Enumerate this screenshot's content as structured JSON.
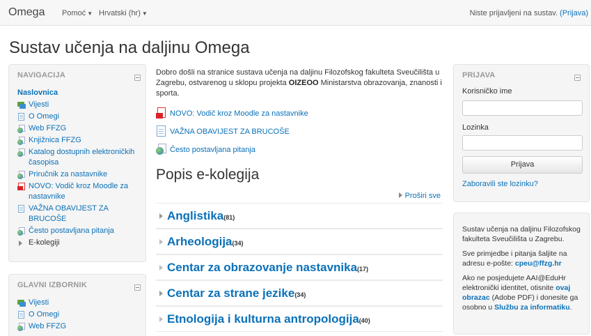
{
  "navbar": {
    "brand": "Omega",
    "help_menu": "Pomoć",
    "language_menu": "Hrvatski (hr)",
    "login_status": "Niste prijavljeni na sustav.",
    "login_link": "(Prijava)"
  },
  "page_title": "Sustav učenja na daljinu Omega",
  "navigation_block": {
    "title": "NAVIGACIJA",
    "items": [
      {
        "label": "Naslovnica",
        "icon": "none"
      },
      {
        "label": "Vijesti",
        "icon": "forum-icon"
      },
      {
        "label": "O Omegi",
        "icon": "page-icon"
      },
      {
        "label": "Web FFZG",
        "icon": "url-icon"
      },
      {
        "label": "Knjižnica FFZG",
        "icon": "url-icon"
      },
      {
        "label": "Katalog dostupnih elektroničkih časopisa",
        "icon": "url-icon"
      },
      {
        "label": "Priručnik za nastavnike",
        "icon": "url-icon"
      },
      {
        "label": "NOVO: Vodič kroz Moodle za nastavnike",
        "icon": "pdf-icon"
      },
      {
        "label": "VAŽNA OBAVIJEST ZA BRUCOŠE",
        "icon": "page-icon"
      },
      {
        "label": "Često postavljana pitanja",
        "icon": "url-icon"
      },
      {
        "label": "E-kolegiji",
        "icon": "expand-arrow-icon"
      }
    ]
  },
  "main_menu_block": {
    "title": "GLAVNI IZBORNIK",
    "items": [
      {
        "label": "Vijesti",
        "icon": "forum-icon"
      },
      {
        "label": "O Omegi",
        "icon": "page-icon"
      },
      {
        "label": "Web FFZG",
        "icon": "url-icon"
      }
    ]
  },
  "main": {
    "intro_pre": "Dobro došli na stranice sustava učenja na daljinu Filozofskog fakulteta Sveučilišta u Zagrebu, ostvarenog u sklopu projekta ",
    "intro_bold": "OIZEOO",
    "intro_post": " Ministarstva obrazovanja, znanosti i sporta.",
    "resources": [
      {
        "label": "NOVO: Vodič kroz Moodle za nastavnike",
        "icon": "pdf-icon"
      },
      {
        "label": "VAŽNA OBAVIJEST ZA BRUCOŠE",
        "icon": "page-icon"
      },
      {
        "label": "Često postavljana pitanja",
        "icon": "url-icon"
      }
    ],
    "section_title": "Popis e-kolegija",
    "expand_all": "Proširi sve",
    "categories": [
      {
        "name": "Anglistika",
        "count": "(81)"
      },
      {
        "name": "Arheologija",
        "count": "(34)"
      },
      {
        "name": "Centar za obrazovanje nastavnika",
        "count": "(17)"
      },
      {
        "name": "Centar za strane jezike",
        "count": "(34)"
      },
      {
        "name": "Etnologija i kulturna antropologija",
        "count": "(40)"
      }
    ]
  },
  "login_block": {
    "title": "PRIJAVA",
    "username_label": "Korisničko ime",
    "password_label": "Lozinka",
    "button": "Prijava",
    "forgot": "Zaboravili ste lozinku?"
  },
  "info_block": {
    "p1": "Sustav učenja na daljinu Filozofskog fakulteta Sveučilišta u Zagrebu.",
    "p2_pre": "Sve primjedbe i pitanja šaljite na adresu e-pošte: ",
    "p2_link": "cpeu@ffzg.hr",
    "p3_pre": "Ako ne posjedujete AAI@EduHr elektronički identitet, otisnite ",
    "p3_link1": "ovaj obrazac",
    "p3_mid": " (Adobe PDF) i donesite ga osobno u ",
    "p3_link2": "Službu za informatiku",
    "p3_post": "."
  },
  "colors": {
    "link": "#0b71b8",
    "navbar_bg": "#f7f7f7",
    "block_bg": "#f5f5f5",
    "block_title": "#999999"
  }
}
